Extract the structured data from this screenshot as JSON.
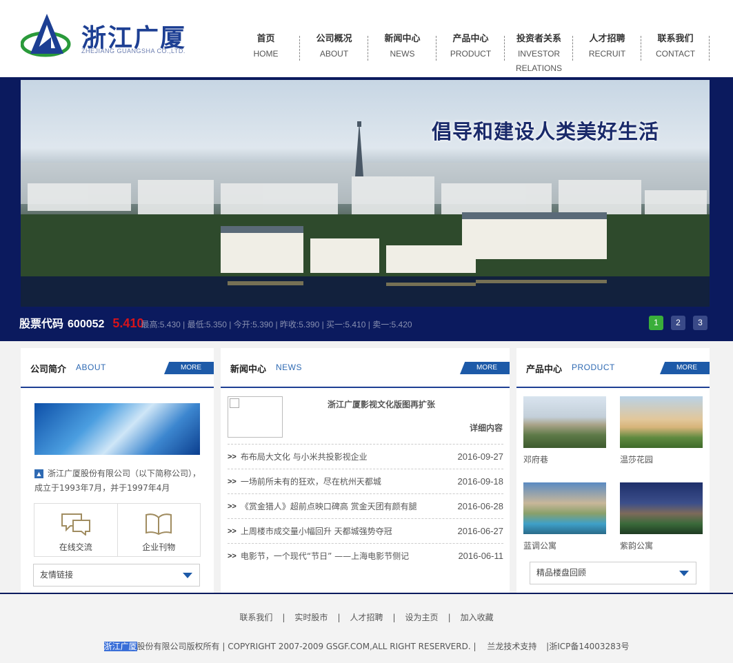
{
  "brand": {
    "logo_cn": "浙江广厦",
    "logo_en": "ZHEJIANG GUANGSHA CO.,LTD.",
    "colors": {
      "primary": "#1d3f93",
      "banner_bg": "#0b1a5e",
      "accent_red": "#d8131b",
      "active_green": "#3aae3a"
    }
  },
  "nav": [
    {
      "cn": "首页",
      "en": "HOME"
    },
    {
      "cn": "公司概况",
      "en": "ABOUT"
    },
    {
      "cn": "新闻中心",
      "en": "NEWS"
    },
    {
      "cn": "产品中心",
      "en": "PRODUCT"
    },
    {
      "cn": "投资者关系",
      "en": "INVESTOR",
      "en2": "RELATIONS"
    },
    {
      "cn": "人才招聘",
      "en": "RECRUIT"
    },
    {
      "cn": "联系我们",
      "en": "CONTACT"
    }
  ],
  "banner": {
    "slogan": "倡导和建设人类美好生活",
    "stock_label": "股票代码",
    "stock_code": "600052",
    "stock_price": "5.410",
    "stock_info": "最高:5.430 | 最低:5.350 | 今开:5.390 | 昨收:5.390 | 买一:5.410 | 卖一:5.420",
    "slides": [
      "1",
      "2",
      "3"
    ],
    "active_slide": "1"
  },
  "about": {
    "title": "公司简介",
    "title_en": "ABOUT",
    "more": "MORE",
    "text": "浙江广厦股份有限公司（以下简称公司），成立于1993年7月，并于1997年4月",
    "quick_links": [
      "在线交流",
      "企业刊物"
    ],
    "friend_links": "友情链接"
  },
  "news": {
    "title": "新闻中心",
    "title_en": "NEWS",
    "more": "MORE",
    "feature_title": "浙江广厦影视文化版图再扩张",
    "feature_more": "详细内容",
    "items": [
      {
        "arrow": ">>",
        "title": "布布局大文化 与小米共投影视企业",
        "date": "2016-09-27"
      },
      {
        "arrow": ">>",
        "title": "一场前所未有的狂欢，尽在杭州天都城",
        "date": "2016-09-18"
      },
      {
        "arrow": ">>",
        "title": "《赏金猎人》超前点映口碑高 赏金天团有颜有腿",
        "date": "2016-06-28"
      },
      {
        "arrow": ">>",
        "title": "上周楼市成交量小幅回升 天都城强势夺冠",
        "date": "2016-06-27"
      },
      {
        "arrow": ">>",
        "title": "电影节，一个现代“节日” ——上海电影节侧记",
        "date": "2016-06-11"
      }
    ]
  },
  "product": {
    "title": "产品中心",
    "title_en": "PRODUCT",
    "more": "MORE",
    "items": [
      {
        "name": "邓府巷"
      },
      {
        "name": "温莎花园"
      },
      {
        "name": "蓝调公寓"
      },
      {
        "name": "紫韵公寓"
      }
    ],
    "review": "精品楼盘回顾"
  },
  "footer": {
    "links": [
      "联系我们",
      "实时股市",
      "人才招聘",
      "设为主页",
      "加入收藏"
    ],
    "separator": "|",
    "copyright_hl": "浙江广厦",
    "copyright_rest": "股份有限公司版权所有 | COPYRIGHT 2007-2009 GSGF.COM,ALL RIGHT RESERVERD. |",
    "support": "兰龙技术支持",
    "icp": "|浙ICP备14003283号"
  }
}
